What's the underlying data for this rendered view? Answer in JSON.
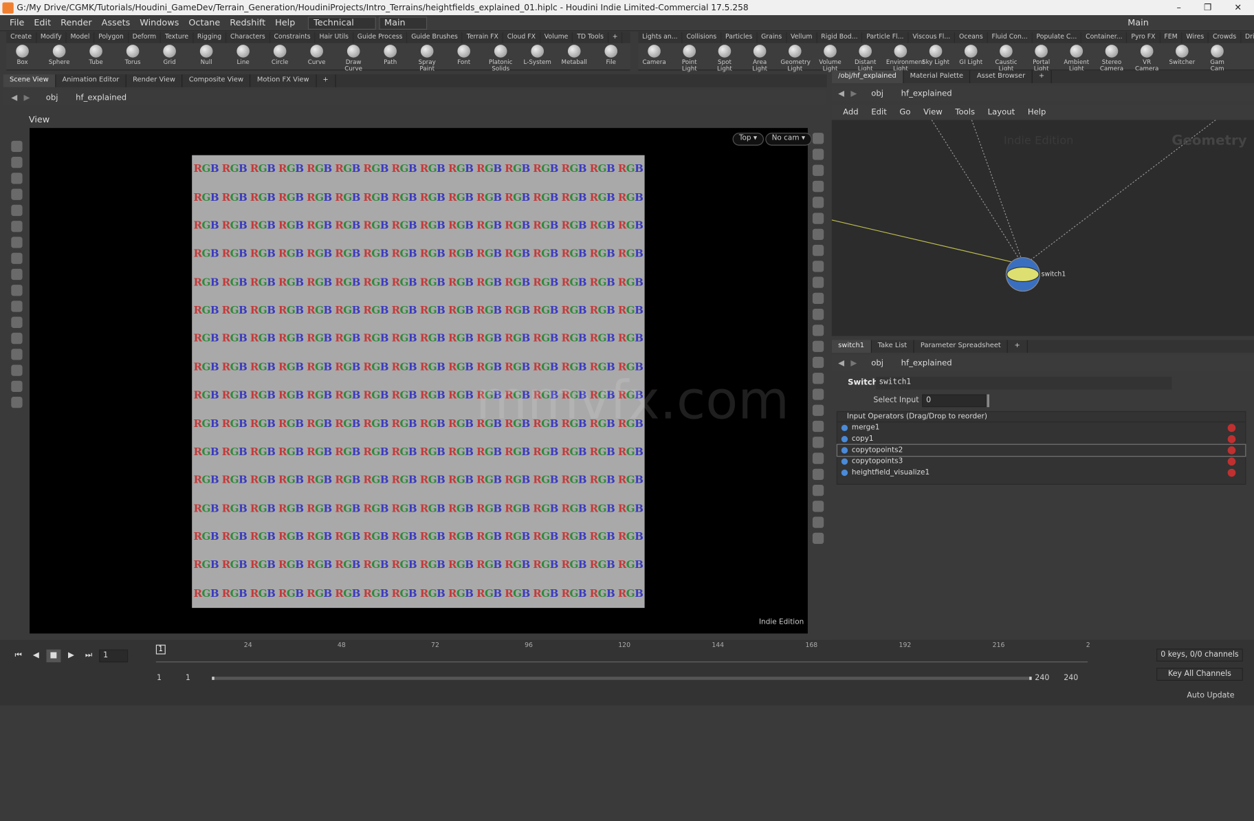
{
  "window": {
    "title": "G:/My Drive/CGMK/Tutorials/Houdini_GameDev/Terrain_Generation/HoudiniProjects/Intro_Terrains/heightfields_explained_01.hiplc - Houdini Indie Limited-Commercial 17.5.258",
    "minimize": "–",
    "maximize": "❐",
    "close": "✕"
  },
  "menubar": {
    "items": [
      "File",
      "Edit",
      "Render",
      "Assets",
      "Windows",
      "Octane",
      "Redshift",
      "Help"
    ],
    "desktop": "Technical",
    "main": "Main",
    "right_desktop": "Main"
  },
  "shelf_left": {
    "tabs": [
      "Create",
      "Modify",
      "Model",
      "Polygon",
      "Deform",
      "Texture",
      "Rigging",
      "Characters",
      "Constraints",
      "Hair Utils",
      "Guide Process",
      "Guide Brushes",
      "Terrain FX",
      "Cloud FX",
      "Volume",
      "TD Tools",
      "+"
    ],
    "tools": [
      "Box",
      "Sphere",
      "Tube",
      "Torus",
      "Grid",
      "Null",
      "Line",
      "Circle",
      "Curve",
      "Draw Curve",
      "Path",
      "Spray Paint",
      "Font",
      "Platonic Solids",
      "L-System",
      "Metaball",
      "File"
    ]
  },
  "shelf_right": {
    "tabs": [
      "Lights an...",
      "Collisions",
      "Particles",
      "Grains",
      "Vellum",
      "Rigid Bod...",
      "Particle Fl...",
      "Viscous Fl...",
      "Oceans",
      "Fluid Con...",
      "Populate C...",
      "Container...",
      "Pyro FX",
      "FEM",
      "Wires",
      "Crowds",
      "Drive Sim...",
      "+"
    ],
    "tools": [
      "Camera",
      "Point Light",
      "Spot Light",
      "Area Light",
      "Geometry Light",
      "Volume Light",
      "Distant Light",
      "Environment Light",
      "Sky Light",
      "GI Light",
      "Caustic Light",
      "Portal Light",
      "Ambient Light",
      "Stereo Camera",
      "VR Camera",
      "Switcher",
      "Gam Cam"
    ]
  },
  "left_pane": {
    "tabs": [
      "Scene View",
      "Animation Editor",
      "Render View",
      "Composite View",
      "Motion FX View",
      "+"
    ],
    "path_obj": "obj",
    "path_node": "hf_explained",
    "view_label": "View",
    "top_btn": "Top ▾",
    "cam_btn": "No cam ▾",
    "cell_text": {
      "r": "R",
      "g": "G",
      "b": "B"
    },
    "watermark": "mmvfx.com",
    "indie": "Indie Edition"
  },
  "network": {
    "tabs": [
      "/obj/hf_explained",
      "Material Palette",
      "Asset Browser",
      "+"
    ],
    "path_obj": "obj",
    "path_node": "hf_explained",
    "menu": [
      "Add",
      "Edit",
      "Go",
      "View",
      "Tools",
      "Layout",
      "Help"
    ],
    "indie": "Indie Edition",
    "context": "Geometry",
    "node_label": "switch1"
  },
  "params": {
    "tabs": [
      "switch1",
      "Take List",
      "Parameter Spreadsheet",
      "+"
    ],
    "path_obj": "obj",
    "path_node": "hf_explained",
    "type": "Switch",
    "name": "switch1",
    "select_input_label": "Select Input",
    "select_input_value": "0",
    "inputs_header": "Input Operators (Drag/Drop to reorder)",
    "inputs": [
      "merge1",
      "copy1",
      "copytopoints2",
      "copytopoints3",
      "heightfield_visualize1"
    ]
  },
  "timeline": {
    "frame": "1",
    "current_marker": "1",
    "ticks": [
      "24",
      "48",
      "72",
      "96",
      "120",
      "144",
      "168",
      "192",
      "216",
      "2"
    ],
    "start": "1",
    "start2": "1",
    "end": "240",
    "end2": "240",
    "keys": "0 keys, 0/0 channels",
    "key_all": "Key All Channels",
    "auto_update": "Auto Update"
  }
}
